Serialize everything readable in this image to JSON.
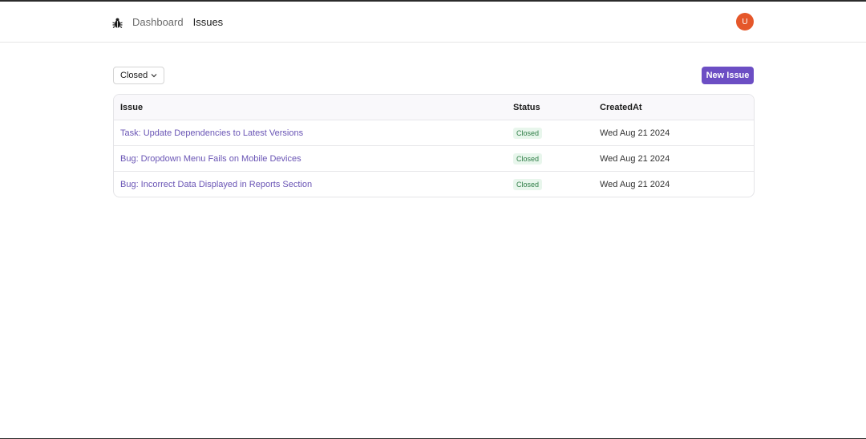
{
  "nav": {
    "dashboard": "Dashboard",
    "issues": "Issues"
  },
  "user": {
    "avatar_initial": "U",
    "avatar_color": "#e5572a"
  },
  "toolbar": {
    "filter_value": "Closed",
    "new_issue_label": "New Issue"
  },
  "table": {
    "headers": [
      "Issue",
      "Status",
      "CreatedAt"
    ],
    "rows": [
      {
        "title": "Task: Update Dependencies to Latest Versions",
        "status": "Closed",
        "created": "Wed Aug 21 2024"
      },
      {
        "title": "Bug: Dropdown Menu Fails on Mobile Devices",
        "status": "Closed",
        "created": "Wed Aug 21 2024"
      },
      {
        "title": "Bug: Incorrect Data Displayed in Reports Section",
        "status": "Closed",
        "created": "Wed Aug 21 2024"
      }
    ]
  },
  "colors": {
    "accent": "#6c4ec4",
    "status_closed_bg": "#e8f6ec",
    "status_closed_fg": "#2e7d46"
  },
  "icons": {
    "logo": "bug-icon",
    "dropdown": "chevron-down-icon"
  }
}
